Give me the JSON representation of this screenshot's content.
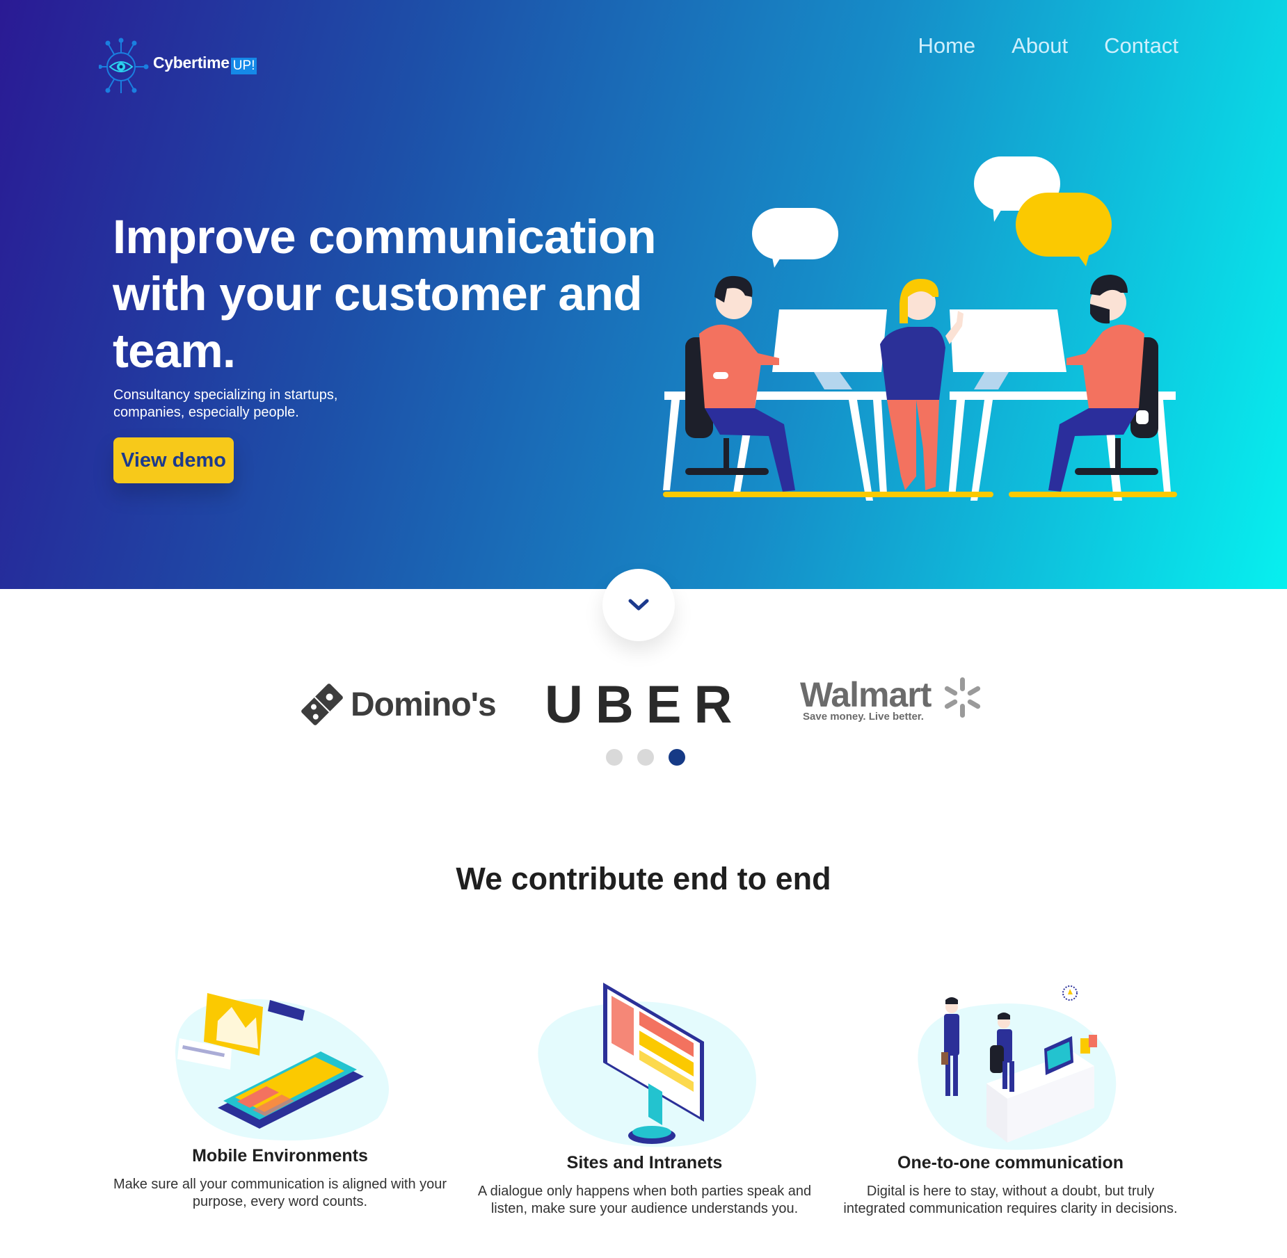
{
  "brand": {
    "name": "Cybertime",
    "badge": "UP!"
  },
  "nav": {
    "items": [
      "Home",
      "About",
      "Contact"
    ]
  },
  "hero": {
    "title": "Improve communication with your customer and team.",
    "subtitle": "Consultancy specializing in startups, companies, especially people.",
    "cta_label": "View demo"
  },
  "clients": {
    "logos": [
      "Domino's",
      "UBER",
      "Walmart"
    ],
    "walmart_tagline": "Save money. Live better.",
    "carousel_active_index": 2,
    "carousel_count": 3
  },
  "section": {
    "title": "We contribute end to end",
    "features": [
      {
        "title": "Mobile Environments",
        "text": "Make sure all your communication is aligned with your purpose, every word counts."
      },
      {
        "title": "Sites and Intranets",
        "text": "A dialogue only happens when both parties speak and listen, make sure your audience understands you."
      },
      {
        "title": "One-to-one communication",
        "text": "Digital is here to stay, without a doubt, but truly integrated communication requires clarity in decisions."
      }
    ]
  },
  "colors": {
    "hero_gradient_start": "#2a1a94",
    "hero_gradient_end": "#07f0ef",
    "cta_bg": "#f7c91a",
    "cta_text": "#1c3a8d",
    "dot_active": "#163a86"
  }
}
